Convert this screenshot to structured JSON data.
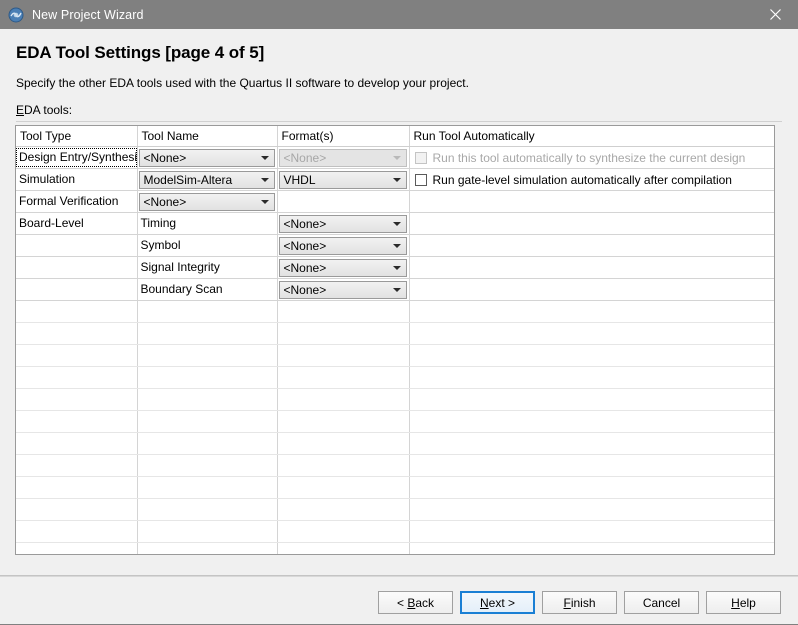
{
  "window": {
    "title": "New Project Wizard",
    "icon": "quartus-app-icon",
    "close_label": "×"
  },
  "header": {
    "page_title": "EDA Tool Settings [page 4 of 5]",
    "subtitle": "Specify the other EDA tools used with the Quartus II software to develop your project.",
    "section_label_mnemonic": "E",
    "section_label_rest": "DA tools:"
  },
  "table": {
    "columns": [
      "Tool Type",
      "Tool Name",
      "Format(s)",
      "Run Tool Automatically"
    ],
    "rows": [
      {
        "tool_type": "Design Entry/Synthesis",
        "tool_type_focused": true,
        "tool_name": {
          "kind": "combo",
          "value": "<None>",
          "disabled": false
        },
        "format": {
          "kind": "combo",
          "value": "<None>",
          "disabled": true
        },
        "run": {
          "kind": "checkbox",
          "label": "Run this tool automatically to synthesize the current design",
          "checked": false,
          "disabled": true
        }
      },
      {
        "tool_type": "Simulation",
        "tool_type_focused": false,
        "tool_name": {
          "kind": "combo",
          "value": "ModelSim-Altera",
          "disabled": false
        },
        "format": {
          "kind": "combo",
          "value": "VHDL",
          "disabled": false
        },
        "run": {
          "kind": "checkbox",
          "label": "Run gate-level simulation automatically after compilation",
          "checked": false,
          "disabled": false
        }
      },
      {
        "tool_type": "Formal Verification",
        "tool_type_focused": false,
        "tool_name": {
          "kind": "combo",
          "value": "<None>",
          "disabled": false
        },
        "format": {
          "kind": "empty"
        },
        "run": {
          "kind": "empty"
        }
      },
      {
        "tool_type": "Board-Level",
        "tool_type_focused": false,
        "tool_name": {
          "kind": "text",
          "value": "Timing"
        },
        "format": {
          "kind": "combo",
          "value": "<None>",
          "disabled": false
        },
        "run": {
          "kind": "empty"
        }
      },
      {
        "tool_type": "",
        "tool_type_focused": false,
        "tool_name": {
          "kind": "text",
          "value": "Symbol"
        },
        "format": {
          "kind": "combo",
          "value": "<None>",
          "disabled": false
        },
        "run": {
          "kind": "empty"
        }
      },
      {
        "tool_type": "",
        "tool_type_focused": false,
        "tool_name": {
          "kind": "text",
          "value": "Signal Integrity"
        },
        "format": {
          "kind": "combo",
          "value": "<None>",
          "disabled": false
        },
        "run": {
          "kind": "empty"
        }
      },
      {
        "tool_type": "",
        "tool_type_focused": false,
        "tool_name": {
          "kind": "text",
          "value": "Boundary Scan"
        },
        "format": {
          "kind": "combo",
          "value": "<None>",
          "disabled": false
        },
        "run": {
          "kind": "empty"
        }
      }
    ]
  },
  "footer": {
    "buttons": [
      {
        "name": "back",
        "pre": "< ",
        "mnemonic": "B",
        "post": "ack",
        "focused": false
      },
      {
        "name": "next",
        "pre": "",
        "mnemonic": "N",
        "post": "ext >",
        "focused": true
      },
      {
        "name": "finish",
        "pre": "",
        "mnemonic": "F",
        "post": "inish",
        "focused": false
      },
      {
        "name": "cancel",
        "pre": "",
        "mnemonic": "",
        "post": "Cancel",
        "focused": false
      },
      {
        "name": "help",
        "pre": "",
        "mnemonic": "H",
        "post": "elp",
        "focused": false
      }
    ]
  },
  "colors": {
    "titlebar": "#808080",
    "dialog_bg": "#f0f0f0",
    "table_bg": "#ffffff",
    "focus_accent": "#1a7fd4",
    "disabled_text": "#a8a8a8"
  }
}
